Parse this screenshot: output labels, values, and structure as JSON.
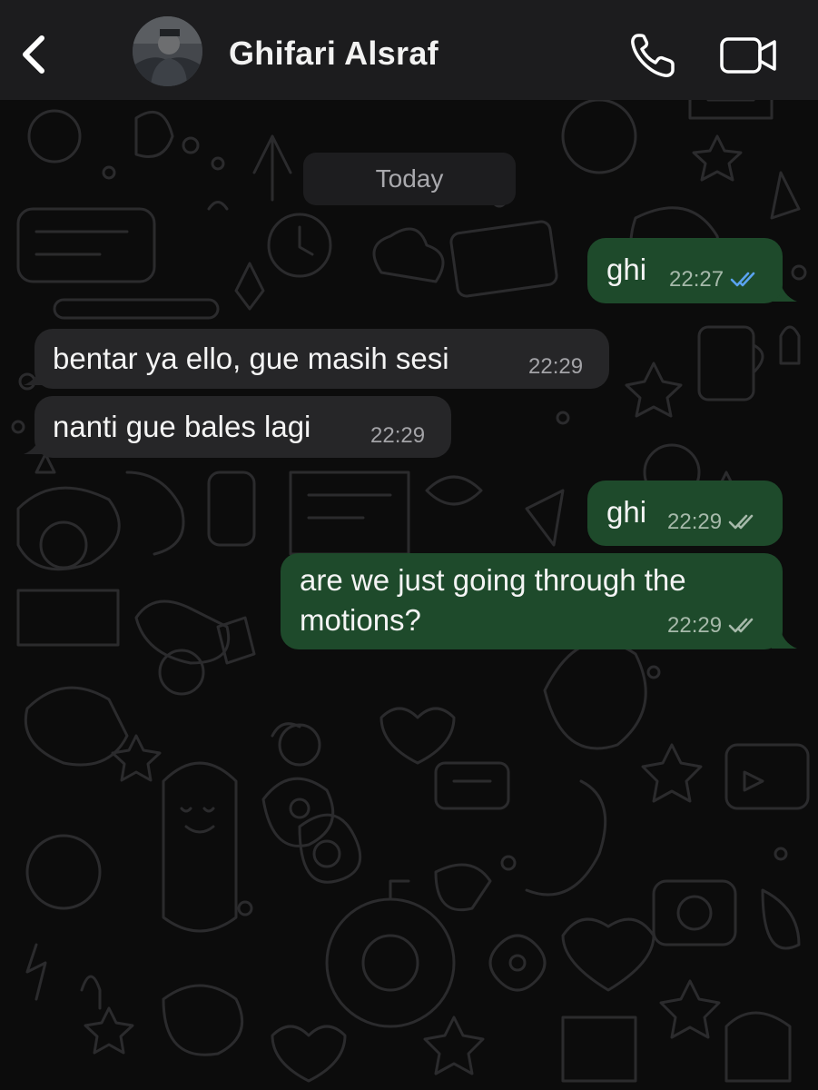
{
  "header": {
    "contact_name": "Ghifari Alsraf"
  },
  "date_chip": "Today",
  "messages": [
    {
      "direction": "outgoing",
      "text": "ghi",
      "time": "22:27",
      "status": "read"
    },
    {
      "direction": "incoming",
      "text": "bentar ya ello, gue masih sesi",
      "time": "22:29"
    },
    {
      "direction": "incoming",
      "text": "nanti gue bales lagi",
      "time": "22:29"
    },
    {
      "direction": "outgoing",
      "text": "ghi",
      "time": "22:29",
      "status": "delivered"
    },
    {
      "direction": "outgoing",
      "text_lines": [
        "are we just going through the",
        "motions?"
      ],
      "time": "22:29",
      "status": "delivered"
    }
  ],
  "colors": {
    "header_bg": "#1c1c1e",
    "outgoing_bubble": "#1e4a2b",
    "incoming_bubble": "#262628",
    "read_ticks": "#5aa3f0",
    "delivered_ticks": "#a6b9aa"
  },
  "icons": {
    "back": "chevron-left-icon",
    "call": "phone-icon",
    "video": "video-camera-icon"
  }
}
